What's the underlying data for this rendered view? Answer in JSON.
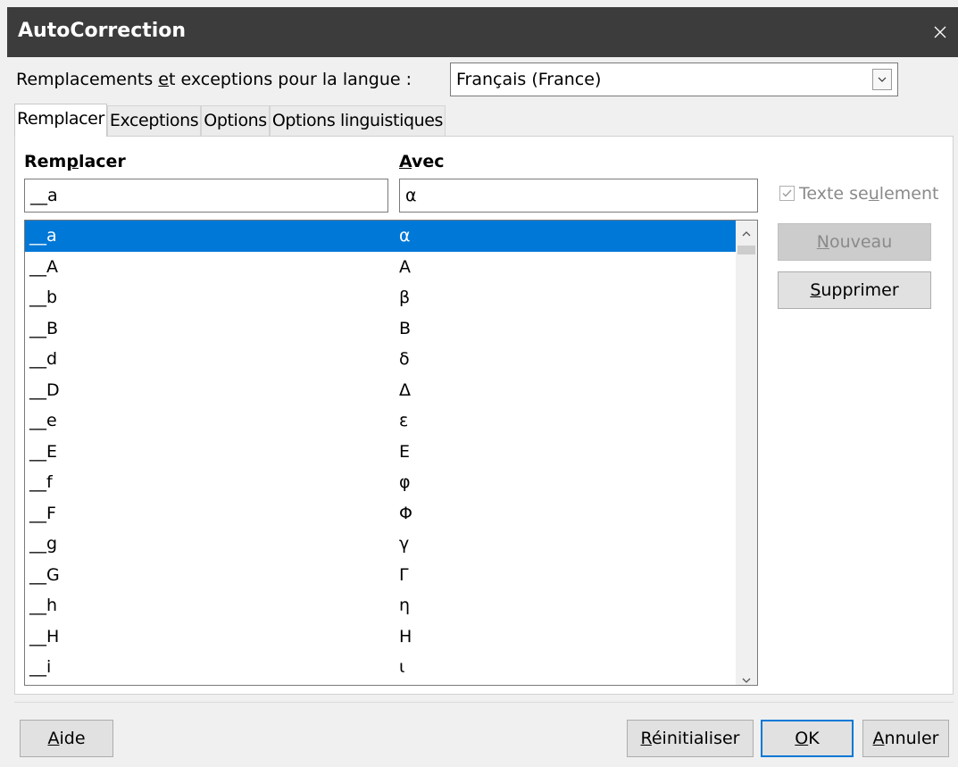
{
  "window": {
    "title": "AutoCorrection"
  },
  "language": {
    "label_prefix": "Remplacements ",
    "label_mnemonic": "e",
    "label_suffix": "t exceptions pour la langue :",
    "selected": "Français (France)"
  },
  "tabs": [
    {
      "label": "Remplacer",
      "active": true
    },
    {
      "label": "Exceptions"
    },
    {
      "label": "Options"
    },
    {
      "label": "Options linguistiques"
    }
  ],
  "replace": {
    "col1_header_prefix": "Rem",
    "col1_header_mnemonic": "p",
    "col1_header_suffix": "lacer",
    "col2_header_mnemonic": "A",
    "col2_header_suffix": "vec",
    "replace_value": "__a",
    "with_value": "α",
    "text_only_prefix": "Texte se",
    "text_only_mnemonic": "u",
    "text_only_suffix": "lement",
    "text_only_checked": true,
    "rows": [
      {
        "from": "__a",
        "to": "α"
      },
      {
        "from": "__A",
        "to": "Α"
      },
      {
        "from": "__b",
        "to": "β"
      },
      {
        "from": "__B",
        "to": "Β"
      },
      {
        "from": "__d",
        "to": "δ"
      },
      {
        "from": "__D",
        "to": "Δ"
      },
      {
        "from": "__e",
        "to": "ε"
      },
      {
        "from": "__E",
        "to": "Ε"
      },
      {
        "from": "__f",
        "to": "φ"
      },
      {
        "from": "__F",
        "to": "Φ"
      },
      {
        "from": "__g",
        "to": "γ"
      },
      {
        "from": "__G",
        "to": "Γ"
      },
      {
        "from": "__h",
        "to": "η"
      },
      {
        "from": "__H",
        "to": "Η"
      },
      {
        "from": "__i",
        "to": "ι"
      }
    ]
  },
  "buttons": {
    "new_mnemonic": "N",
    "new_rest": "ouveau",
    "delete_mnemonic": "S",
    "delete_rest": "upprimer",
    "help_mnemonic": "A",
    "help_rest": "ide",
    "reset_mnemonic": "R",
    "reset_rest": "éinitialiser",
    "ok_mnemonic": "O",
    "ok_rest": "K",
    "cancel_mnemonic": "A",
    "cancel_rest": "nnuler"
  },
  "colors": {
    "titlebar": "#3c3c3c",
    "selection": "#0078d7",
    "accent": "#0078d7"
  }
}
